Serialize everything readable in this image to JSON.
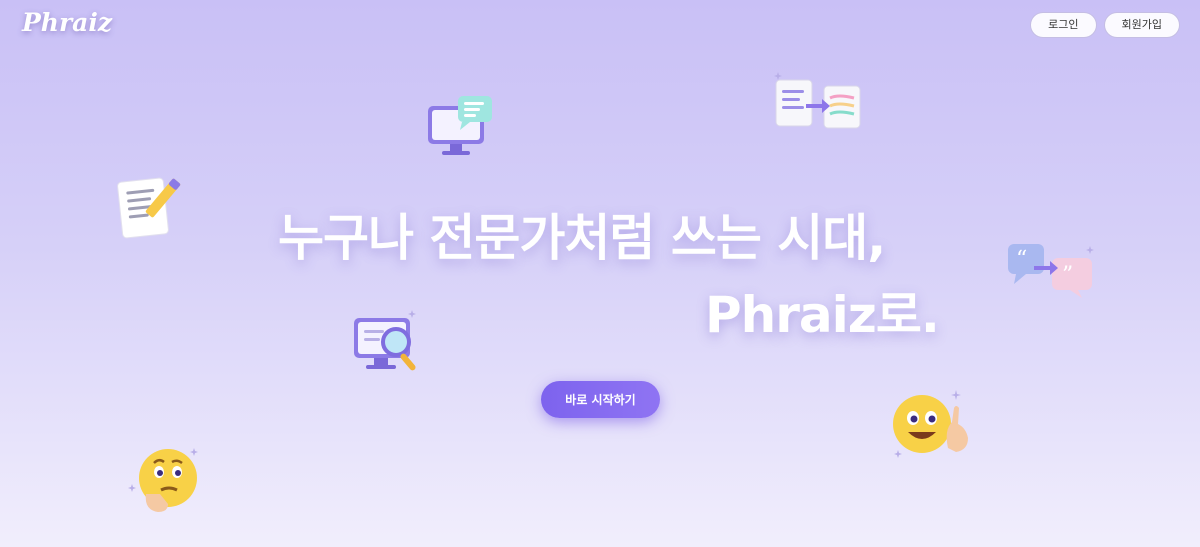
{
  "header": {
    "logo": "Phraiz",
    "login_label": "로그인",
    "signup_label": "회원가입"
  },
  "hero": {
    "line1": "누구나 전문가처럼 쓰는 시대,",
    "line2": "Phraiz로.",
    "cta_label": "바로 시작하기"
  },
  "illustrations": [
    "monitor-chat-icon",
    "document-transform-icon",
    "notepad-pencil-icon",
    "quote-translate-icon",
    "monitor-search-icon",
    "thinking-emoji-icon",
    "pointing-emoji-icon"
  ],
  "colors": {
    "background_top": "#c9c0f6",
    "background_bottom": "#f1eefc",
    "cta": "#7d63ee",
    "text": "#ffffff"
  }
}
